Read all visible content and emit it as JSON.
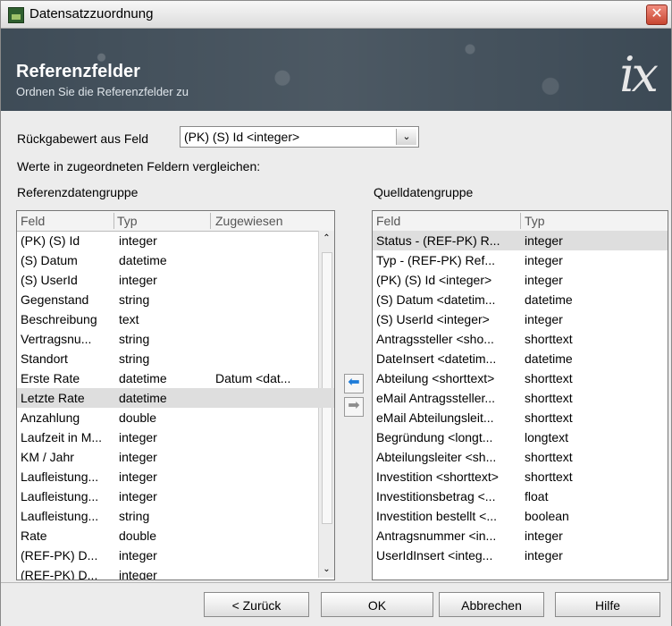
{
  "window": {
    "title": "Datensatzzuordnung",
    "close_label": "✕"
  },
  "header": {
    "title": "Referenzfelder",
    "subtitle": "Ordnen Sie die Referenzfelder zu",
    "logo": "ix"
  },
  "form": {
    "return_label": "Rückgabewert aus Feld",
    "return_value": "(PK) (S) Id <integer>",
    "compare_label": "Werte in zugeordneten Feldern vergleichen:",
    "reference_group_label": "Referenzdatengruppe",
    "source_group_label": "Quelldatengruppe"
  },
  "reference_table": {
    "columns": [
      "Feld",
      "Typ",
      "Zugewiesen"
    ],
    "rows": [
      [
        "(PK) (S) Id",
        "integer",
        ""
      ],
      [
        "(S) Datum",
        "datetime",
        ""
      ],
      [
        "(S) UserId",
        "integer",
        ""
      ],
      [
        "Gegenstand",
        "string",
        ""
      ],
      [
        "Beschreibung",
        "text",
        ""
      ],
      [
        "Vertragsnu...",
        "string",
        ""
      ],
      [
        "Standort",
        "string",
        ""
      ],
      [
        "Erste Rate",
        "datetime",
        "Datum <dat..."
      ],
      [
        "Letzte Rate",
        "datetime",
        ""
      ],
      [
        "Anzahlung",
        "double",
        ""
      ],
      [
        "Laufzeit in M...",
        "integer",
        ""
      ],
      [
        "KM / Jahr",
        "integer",
        ""
      ],
      [
        "Laufleistung...",
        "integer",
        ""
      ],
      [
        "Laufleistung...",
        "integer",
        ""
      ],
      [
        "Laufleistung...",
        "string",
        ""
      ],
      [
        "Rate",
        "double",
        ""
      ],
      [
        "(REF-PK) D...",
        "integer",
        ""
      ],
      [
        "(REF-PK) D...",
        "integer",
        ""
      ]
    ]
  },
  "source_table": {
    "columns": [
      "Feld",
      "Typ"
    ],
    "rows": [
      [
        "Status - (REF-PK) R...",
        "integer"
      ],
      [
        "Typ - (REF-PK) Ref...",
        "integer"
      ],
      [
        "(PK) (S) Id <integer>",
        "integer"
      ],
      [
        "(S) Datum <datetim...",
        "datetime"
      ],
      [
        "(S) UserId <integer>",
        "integer"
      ],
      [
        "Antragssteller <sho...",
        "shorttext"
      ],
      [
        "DateInsert <datetim...",
        "datetime"
      ],
      [
        "Abteilung <shorttext>",
        "shorttext"
      ],
      [
        "eMail Antragssteller...",
        "shorttext"
      ],
      [
        "eMail Abteilungsleit...",
        "shorttext"
      ],
      [
        "Begründung <longt...",
        "longtext"
      ],
      [
        "Abteilungsleiter <sh...",
        "shorttext"
      ],
      [
        "Investition <shorttext>",
        "shorttext"
      ],
      [
        "Investitionsbetrag <...",
        "float"
      ],
      [
        "Investition bestellt <...",
        "boolean"
      ],
      [
        "Antragsnummer <in...",
        "integer"
      ],
      [
        "UserIdInsert <integ...",
        "integer"
      ]
    ]
  },
  "buttons": {
    "back": "< Zurück",
    "ok": "OK",
    "cancel": "Abbrechen",
    "help": "Hilfe"
  },
  "icons": {
    "assign": "left-arrow-icon",
    "remove": "right-arrow-icon",
    "close": "close-icon"
  }
}
